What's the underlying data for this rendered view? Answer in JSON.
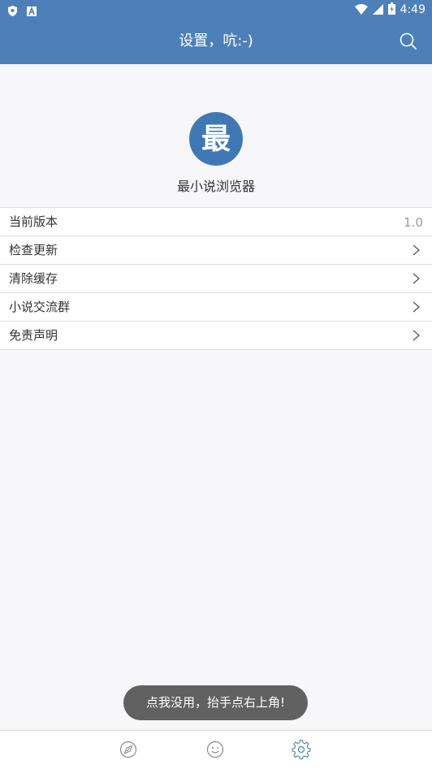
{
  "status_bar": {
    "time": "4:49",
    "left_icons": [
      "shield-icon",
      "a-box-icon"
    ],
    "right_icons": [
      "wifi-icon",
      "signal-icon",
      "battery-icon"
    ]
  },
  "header": {
    "title": "设置，吭:-)",
    "search_icon": "search-icon"
  },
  "app": {
    "logo_text": "最",
    "name": "最小说浏览器"
  },
  "menu": {
    "items": [
      {
        "label": "当前版本",
        "value": "1.0"
      },
      {
        "label": "检查更新"
      },
      {
        "label": "清除缓存"
      },
      {
        "label": "小说交流群"
      },
      {
        "label": "免责声明"
      }
    ]
  },
  "toast": {
    "text": "点我没用，抬手点右上角!"
  },
  "bottom_nav": {
    "items": [
      {
        "icon": "compass-icon",
        "active": false
      },
      {
        "icon": "smiley-icon",
        "active": false
      },
      {
        "icon": "gear-icon",
        "active": true
      }
    ]
  },
  "colors": {
    "primary": "#4d80b8",
    "logo": "#3f78b5",
    "active_tab": "#4d80b8",
    "inactive_tab": "#8a8a8a",
    "toast_bg": "#616161"
  }
}
